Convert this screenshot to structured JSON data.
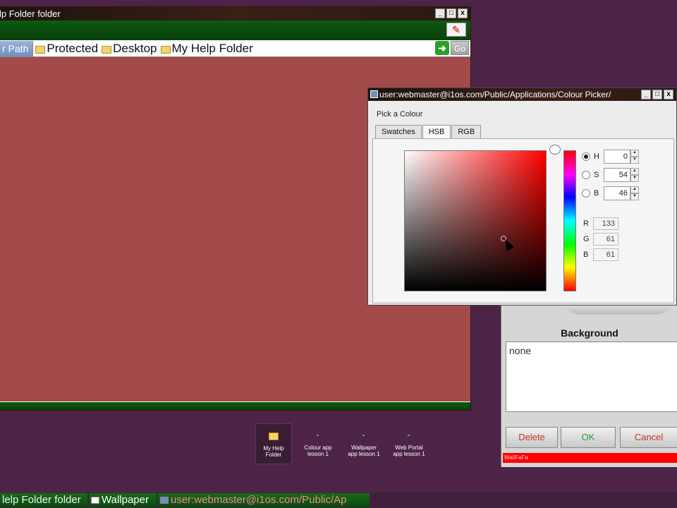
{
  "folder_window": {
    "title": "lp Folder folder",
    "path_label": "r Path",
    "breadcrumbs": [
      "Protected",
      "Desktop",
      "My Help Folder"
    ],
    "go_label": "Go",
    "window_buttons": [
      "_",
      "□",
      "x"
    ]
  },
  "properties_panel": {
    "heading": "Background",
    "value": "none",
    "delete_label": "Delete",
    "ok_label": "OK",
    "cancel_label": "Cancel",
    "status_text": "WallFaFa"
  },
  "picker": {
    "title": "user:webmaster@i1os.com/Public/Applications/Colour Picker/",
    "group_heading": "Pick a Colour",
    "tabs": [
      {
        "label": "Swatches",
        "active": false
      },
      {
        "label": "HSB",
        "active": true
      },
      {
        "label": "RGB",
        "active": false
      }
    ],
    "hsb": [
      {
        "label": "H",
        "value": "0",
        "selected": true
      },
      {
        "label": "S",
        "value": "54",
        "selected": false
      },
      {
        "label": "B",
        "value": "46",
        "selected": false
      }
    ],
    "rgb": [
      {
        "label": "R",
        "value": "133"
      },
      {
        "label": "G",
        "value": "61"
      },
      {
        "label": "B",
        "value": "61"
      }
    ],
    "selected_color": "#853d3d"
  },
  "desktop_icons": [
    {
      "label": "My Help Folder",
      "selected": true
    },
    {
      "label": "Colour app lesson 1",
      "selected": false
    },
    {
      "label": "Wallpaper app lesson 1",
      "selected": false
    },
    {
      "label": "Web Portal app lesson 1",
      "selected": false
    }
  ],
  "taskbar": {
    "items": [
      "lelp Folder folder",
      "Wallpaper",
      "user:webmaster@i1os.com/Public/Ap"
    ]
  },
  "colors": {
    "desktop": "#4d2448",
    "folder_bg": "#a34a4a",
    "title_green": "#0e5a10",
    "status_red": "#ff0000"
  }
}
